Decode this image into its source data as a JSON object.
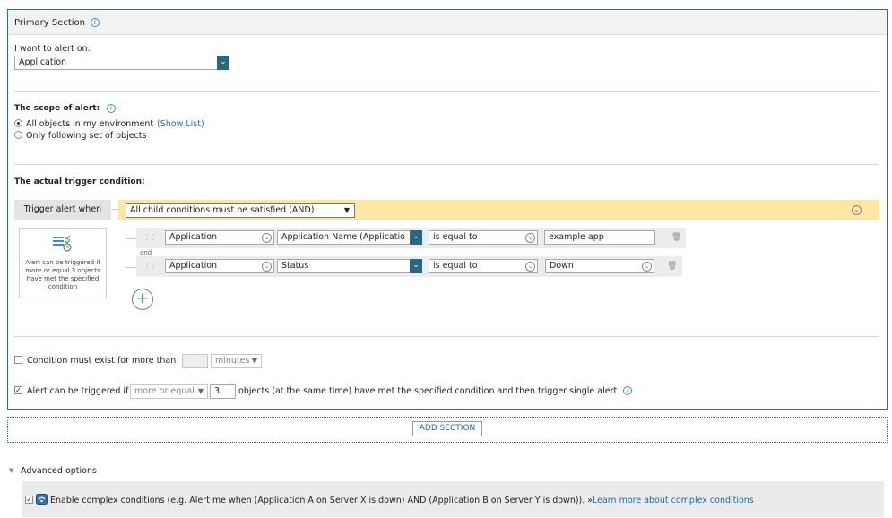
{
  "primary_section": {
    "title": "Primary Section",
    "alert_on_label": "I want to alert on:",
    "alert_on_value": "Application",
    "scope_label": "The scope of alert:",
    "scope_option_all": "All objects in my environment",
    "show_list_link": "(Show List)",
    "scope_option_following": "Only following set of objects",
    "trigger_condition_label": "The actual trigger condition:",
    "trigger_alert_when_label": "Trigger alert when",
    "child_conditions_value": "All child conditions must be satisfied (AND)",
    "helper_text": "Alert can be triggered if more or equal 3 objects have met the specified condition",
    "conditions": [
      {
        "object": "Application",
        "property": "Application Name (Applicatio",
        "operator": "is equal to",
        "value": "example app"
      },
      {
        "object": "Application",
        "property": "Status",
        "operator": "is equal to",
        "value": "Down"
      }
    ],
    "and_label": "and",
    "add_condition_icon": "+",
    "duration_label": "Condition must exist for more than",
    "duration_value": "",
    "duration_unit": "minutes",
    "triggered_if_label": "Alert can be triggered if",
    "triggered_if_operator": "more or equal",
    "triggered_if_count": "3",
    "triggered_if_suffix": "objects (at the same time) have met the specified condition and then trigger single alert"
  },
  "add_section_label": "ADD SECTION",
  "advanced": {
    "title": "Advanced options",
    "complex_text": "Enable complex conditions (e.g. Alert me when (Application A on Server X is down) AND (Application B on Server Y is down)). »",
    "learn_more_link": "Learn more about complex conditions"
  },
  "colors": {
    "accent": "#2a6882",
    "highlight": "#fbe6a2",
    "link": "#1c6ea4"
  }
}
